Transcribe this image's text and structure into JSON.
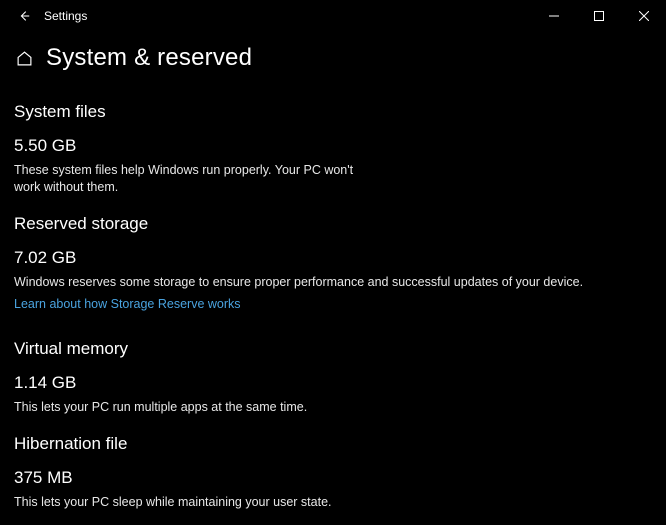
{
  "app": {
    "title": "Settings"
  },
  "page": {
    "title": "System & reserved"
  },
  "sections": {
    "system_files": {
      "heading": "System files",
      "value": "5.50 GB",
      "desc": "These system files help Windows run properly. Your PC won't work without them."
    },
    "reserved_storage": {
      "heading": "Reserved storage",
      "value": "7.02 GB",
      "desc": "Windows reserves some storage to ensure proper performance and successful updates of your device.",
      "link": "Learn about how Storage Reserve works"
    },
    "virtual_memory": {
      "heading": "Virtual memory",
      "value": "1.14 GB",
      "desc": "This lets your PC run multiple apps at the same time."
    },
    "hibernation_file": {
      "heading": "Hibernation file",
      "value": "375 MB",
      "desc": "This lets your PC sleep while maintaining your user state."
    }
  }
}
